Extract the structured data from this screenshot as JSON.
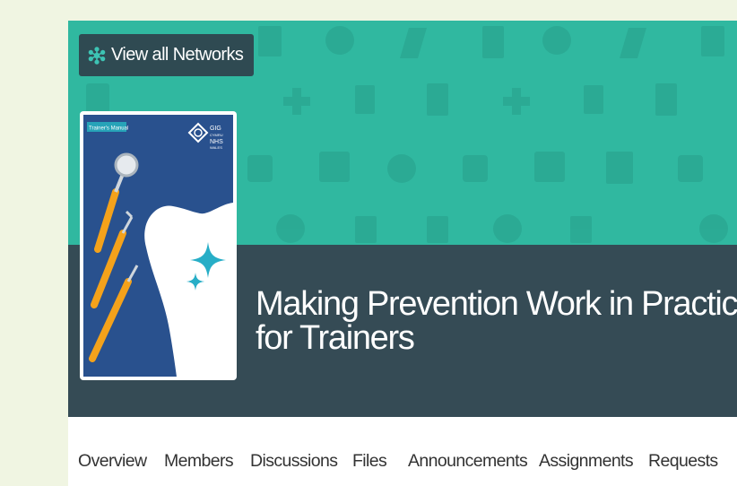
{
  "header": {
    "network_button_label": "View all Networks",
    "network_button_icon": "network-icon",
    "title_line1": "Making Prevention Work in Practice (MPW",
    "title_line2": "for Trainers"
  },
  "cover": {
    "manual_label": "Trainer's Manual",
    "logo_text": [
      "GIG",
      "CYMRU",
      "NHS",
      "WALES"
    ]
  },
  "tabs": [
    {
      "label": "Overview"
    },
    {
      "label": "Members"
    },
    {
      "label": "Discussions"
    },
    {
      "label": "Files"
    },
    {
      "label": "Announcements"
    },
    {
      "label": "Assignments"
    },
    {
      "label": "Requests"
    }
  ],
  "colors": {
    "page_background": "#f0f5e2",
    "banner_teal": "#30b8a0",
    "banner_dark": "#354b55",
    "button_dark": "#2f4a52",
    "icon_teal": "#3dc4b4",
    "cover_blue": "#29518e",
    "instrument_orange": "#f4a21b"
  }
}
